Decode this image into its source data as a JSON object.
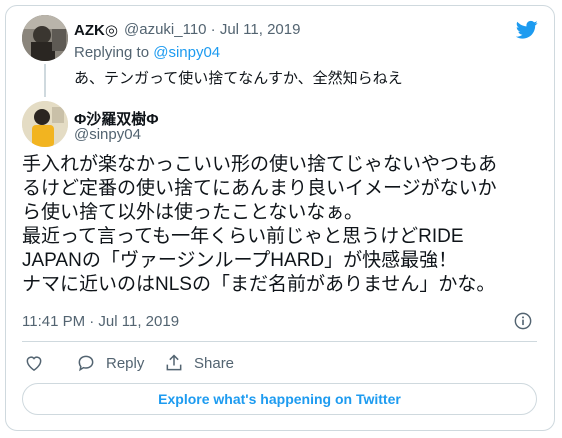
{
  "reply_tweet": {
    "author_name": "AZK◎",
    "handle": "@azuki_110",
    "separator": "·",
    "date": "Jul 11, 2019",
    "replying_to_prefix": "Replying to",
    "replying_to_handle": "@sinpy04",
    "text": "あ、テンガって使い捨てなんすか、全然知らねえ"
  },
  "main_tweet": {
    "author_name": "Φ沙羅双樹Φ",
    "handle": "@sinpy04",
    "lines": [
      "手入れが楽なかっこいい形の使い捨てじゃないやつもあ",
      "るけど定番の使い捨てにあんまり良いイメージがないか",
      "ら使い捨て以外は使ったことないなぁ。",
      "最近って言っても一年くらい前じゃと思うけどRIDE",
      "JAPANの「ヴァージンループHARD」が快感最強！",
      "ナマに近いのはNLSの「まだ名前がありません」かな。"
    ],
    "timestamp": "11:41 PM · Jul 11, 2019"
  },
  "actions": {
    "reply": "Reply",
    "share": "Share"
  },
  "explore_button": "Explore what's happening on Twitter",
  "colors": {
    "accent": "#1d9bf0",
    "muted": "#536471",
    "border": "#cfd9de"
  }
}
